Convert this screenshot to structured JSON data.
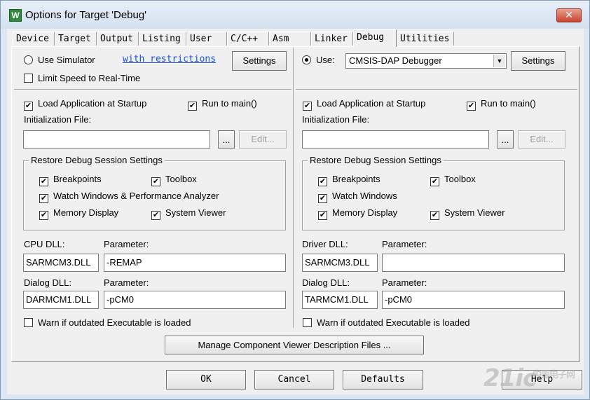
{
  "window": {
    "title": "Options for Target 'Debug'",
    "icon": "keil-app-icon",
    "close_label": "✕"
  },
  "tabs": [
    {
      "label": "Device"
    },
    {
      "label": "Target"
    },
    {
      "label": "Output"
    },
    {
      "label": "Listing"
    },
    {
      "label": "User"
    },
    {
      "label": "C/C++"
    },
    {
      "label": "Asm"
    },
    {
      "label": "Linker"
    },
    {
      "label": "Debug",
      "active": true
    },
    {
      "label": "Utilities"
    }
  ],
  "left": {
    "simulator_label": "Use Simulator",
    "simulator_selected": false,
    "restrictions_link": "with restrictions",
    "settings_label": "Settings",
    "limit_speed_label": "Limit Speed to Real-Time",
    "limit_speed_checked": false,
    "load_app_label": "Load Application at Startup",
    "load_app_checked": true,
    "run_main_label": "Run to main()",
    "run_main_checked": true,
    "init_file_label": "Initialization File:",
    "init_file_value": "",
    "browse_label": "...",
    "edit_label": "Edit...",
    "restore_group_title": "Restore Debug Session Settings",
    "restore": {
      "breakpoints": "Breakpoints",
      "toolbox": "Toolbox",
      "watch": "Watch Windows & Performance Analyzer",
      "memory": "Memory Display",
      "system_viewer": "System Viewer"
    },
    "cpu_dll_label": "CPU DLL:",
    "cpu_dll_value": "SARMCM3.DLL",
    "cpu_param_label": "Parameter:",
    "cpu_param_value": "-REMAP",
    "dialog_dll_label": "Dialog DLL:",
    "dialog_dll_value": "DARMCM1.DLL",
    "dialog_param_label": "Parameter:",
    "dialog_param_value": "-pCM0",
    "warn_label": "Warn if outdated Executable is loaded",
    "warn_checked": false
  },
  "right": {
    "use_label": "Use:",
    "use_selected": true,
    "debugger_value": "CMSIS-DAP Debugger",
    "settings_label": "Settings",
    "load_app_label": "Load Application at Startup",
    "load_app_checked": true,
    "run_main_label": "Run to main()",
    "run_main_checked": true,
    "init_file_label": "Initialization File:",
    "init_file_value": "",
    "browse_label": "...",
    "edit_label": "Edit...",
    "restore_group_title": "Restore Debug Session Settings",
    "restore": {
      "breakpoints": "Breakpoints",
      "toolbox": "Toolbox",
      "watch": "Watch Windows",
      "memory": "Memory Display",
      "system_viewer": "System Viewer"
    },
    "driver_dll_label": "Driver DLL:",
    "driver_dll_value": "SARMCM3.DLL",
    "driver_param_label": "Parameter:",
    "driver_param_value": "",
    "dialog_dll_label": "Dialog DLL:",
    "dialog_dll_value": "TARMCM1.DLL",
    "dialog_param_label": "Parameter:",
    "dialog_param_value": "-pCM0",
    "warn_label": "Warn if outdated Executable is loaded",
    "warn_checked": false
  },
  "manage_button_label": "Manage Component Viewer Description Files ...",
  "footer": {
    "ok_label": "OK",
    "cancel_label": "Cancel",
    "defaults_label": "Defaults",
    "help_label": "Help"
  },
  "watermark": {
    "text": "21ic",
    "sub": "中国电子网"
  },
  "check_glyph": "✔"
}
